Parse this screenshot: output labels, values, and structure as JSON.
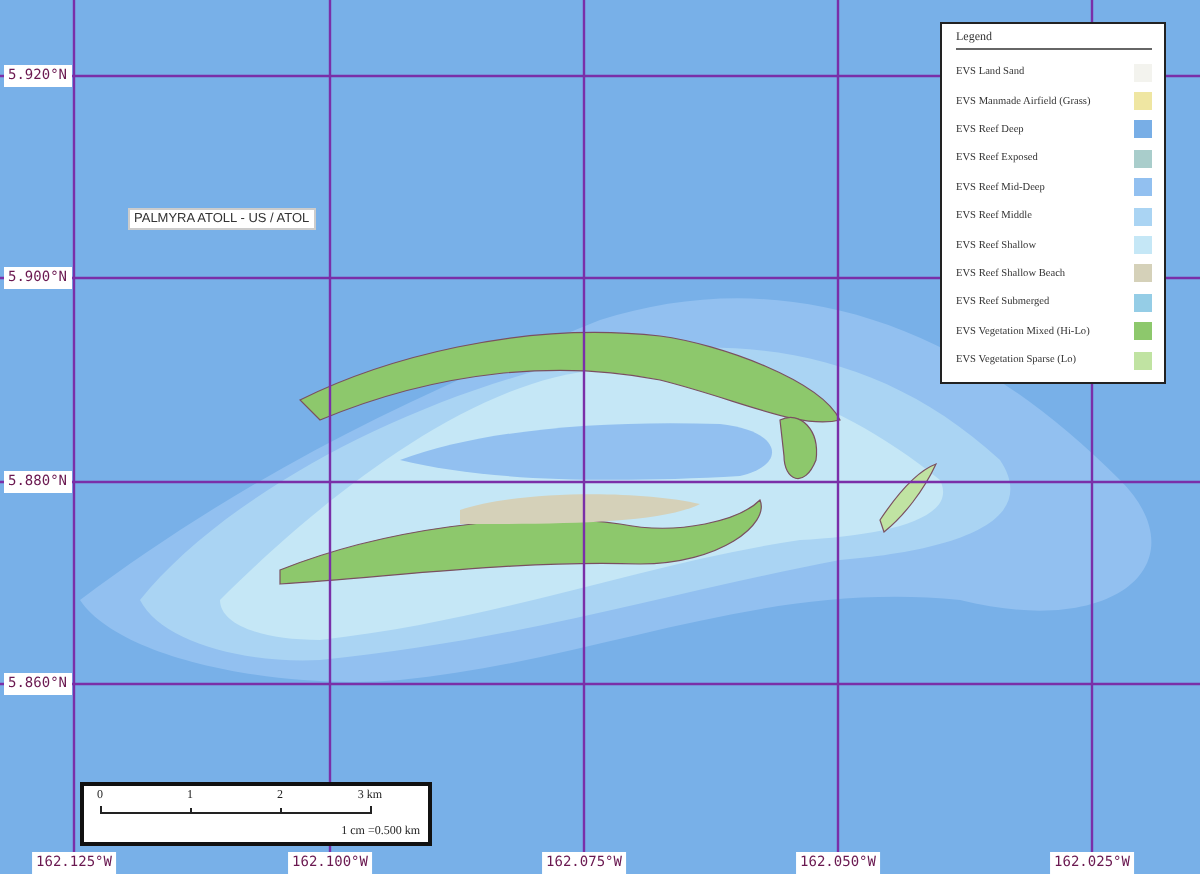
{
  "map": {
    "latitudes": [
      {
        "label": "5.920°N"
      },
      {
        "label": "5.900°N"
      },
      {
        "label": "5.880°N"
      },
      {
        "label": "5.860°N"
      }
    ],
    "longitudes": [
      {
        "label": "162.125°W"
      },
      {
        "label": "162.100°W"
      },
      {
        "label": "162.075°W"
      },
      {
        "label": "162.050°W"
      },
      {
        "label": "162.025°W"
      }
    ],
    "place_label": "PALMYRA ATOLL - US / ATOL"
  },
  "legend": {
    "title": "Legend",
    "items": [
      {
        "label": "EVS Land Sand",
        "color": "#f3f3ee"
      },
      {
        "label": "EVS Manmade Airfield (Grass)",
        "color": "#efe6a2"
      },
      {
        "label": "EVS Reef Deep",
        "color": "#78aee6"
      },
      {
        "label": "EVS Reef Exposed",
        "color": "#a9cdcb"
      },
      {
        "label": "EVS Reef Mid-Deep",
        "color": "#92c0f0"
      },
      {
        "label": "EVS Reef Middle",
        "color": "#aad4f3"
      },
      {
        "label": "EVS Reef Shallow",
        "color": "#c5e7f6"
      },
      {
        "label": "EVS Reef Shallow Beach",
        "color": "#d5d1b9"
      },
      {
        "label": "EVS Reef Submerged",
        "color": "#95cde6"
      },
      {
        "label": "EVS Vegetation Mixed (Hi-Lo)",
        "color": "#8dc86c"
      },
      {
        "label": "EVS Vegetation Sparse (Lo)",
        "color": "#c0e3a2"
      }
    ]
  },
  "scale_bar": {
    "ticks": [
      "0",
      "1",
      "2",
      "3 km"
    ],
    "note": "1 cm =0.500 km"
  }
}
